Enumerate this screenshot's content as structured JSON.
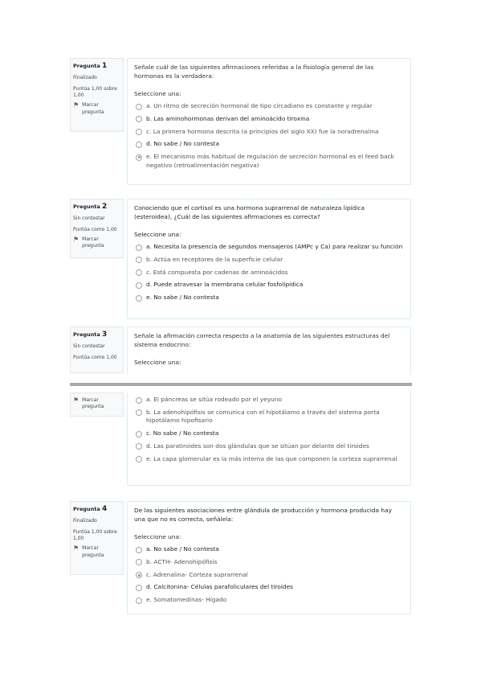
{
  "questions": [
    {
      "label": "Pregunta",
      "number": "1",
      "state": "Finalizado",
      "grade": "Puntúa 1,00 sobre 1,00",
      "flag": "Marcar pregunta",
      "text": "Señale cuál de las siguientes afirmaciones referidas a la fisiología general de las hormonas es la verdadera:",
      "prompt": "Seleccione una:",
      "options": [
        "a. Un ritmo de secreción hormonal de tipo circadiano es constante y regular",
        "b. Las aminohormonas derivan del aminoácido tiroxina",
        "c. La primera hormona descrita (a principios del siglo XX) fue la noradrenalina",
        "d. No sabe / No contesta",
        "e. El mecanismo más habitual de regulación de secreción hormonal es el feed back negativo (retroalimentación negativa)"
      ],
      "selected_option": "e"
    },
    {
      "label": "Pregunta",
      "number": "2",
      "state": "Sin contestar",
      "grade": "Puntúa como 1,00",
      "flag": "Marcar pregunta",
      "text": "Conociendo que el cortisol es una hormona suprarrenal de naturaleza lipídica (esteroidea), ¿Cuál de las siguientes afirmaciones es correcta?",
      "prompt": "Seleccione una:",
      "options": [
        "a. Necesita la presencia de segundos mensajeros (AMPc y Ca) para realizar su función",
        "b. Actúa en receptores de la superficie celular",
        "c. Está compuesta por cadenas de aminoácidos",
        "d. Puede atravesar la membrana celular fosfolipídica",
        "e. No sabe / No contesta"
      ]
    },
    {
      "label": "Pregunta",
      "number": "3",
      "state": "Sin contestar",
      "grade": "Puntúa como 1,00",
      "flag": "Marcar pregunta",
      "text": "Señale la afirmación correcta respecto a la anatomía de las siguientes estructuras del sistema endocrino:",
      "prompt": "Seleccione una:",
      "options": [
        "a. El páncreas se sitúa rodeado por el yeyuno",
        "b. La adenohipófisis se comunica con el hipotálamo a través del sistema porta hipotálamo hipofisario",
        "c. No sabe / No contesta",
        "d. Las paratiroides son dos glándulas que se sitúan por delante del tiroides",
        "e. La capa glomerular es la más interna de las que componen la corteza suprarrenal"
      ]
    },
    {
      "label": "Pregunta",
      "number": "4",
      "state": "Finalizado",
      "grade": "Puntúa 1,00 sobre 1,00",
      "flag": "Marcar pregunta",
      "text": "De las siguientes asociaciones entre glándula de producción y hormona producida hay una que no es correcta, señálela:",
      "prompt": "Seleccione una:",
      "options": [
        "a. No sabe / No contesta",
        "b. ACTH- Adenohipófisis",
        "c. Adrenalina- Corteza suprarrenal",
        "d. Calcitonina- Células parafoliculares del tiroides",
        "e. Somatomedinas- Hígado"
      ],
      "selected_option": "c"
    }
  ]
}
